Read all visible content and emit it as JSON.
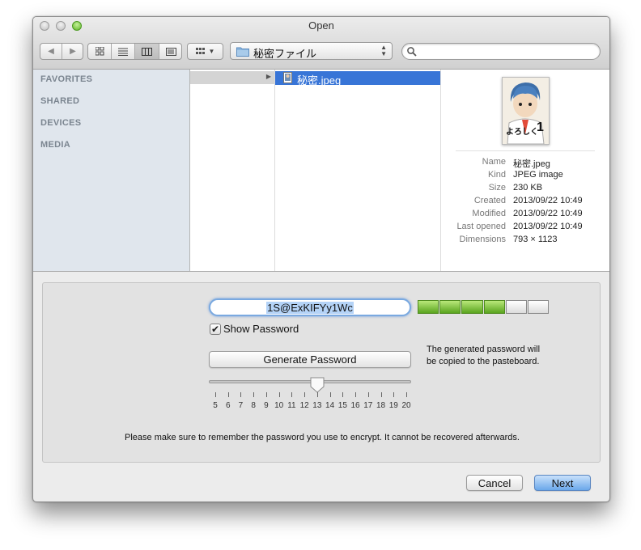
{
  "window": {
    "title": "Open"
  },
  "toolbar": {
    "path_label": "秘密ファイル",
    "search_placeholder": ""
  },
  "sidebar": {
    "sections": [
      "FAVORITES",
      "SHARED",
      "DEVICES",
      "MEDIA"
    ]
  },
  "browser": {
    "selected_file": "秘密.jpeg"
  },
  "preview": {
    "thumbnail_title": "よろしく",
    "thumbnail_number": "1",
    "info": [
      {
        "key": "Name",
        "value": "秘密.jpeg"
      },
      {
        "key": "Kind",
        "value": "JPEG image"
      },
      {
        "key": "Size",
        "value": "230 KB"
      },
      {
        "key": "Created",
        "value": "2013/09/22 10:49"
      },
      {
        "key": "Modified",
        "value": "2013/09/22 10:49"
      },
      {
        "key": "Last opened",
        "value": "2013/09/22 10:49"
      },
      {
        "key": "Dimensions",
        "value": "793 × 1123"
      }
    ]
  },
  "password_panel": {
    "password": "1S@ExKIFYy1Wc",
    "strength_filled": 4,
    "strength_total": 6,
    "show_password_label": "Show Password",
    "show_password_checked": true,
    "generate_label": "Generate Password",
    "hint": "The generated password will be copied to the pasteboard.",
    "length_value": 13,
    "length_ticks": [
      "5",
      "6",
      "7",
      "8",
      "9",
      "10",
      "11",
      "12",
      "13",
      "14",
      "15",
      "16",
      "17",
      "18",
      "19",
      "20"
    ],
    "notice": "Please make sure to remember the password you use to encrypt. It cannot be recovered afterwards."
  },
  "buttons": {
    "cancel": "Cancel",
    "next": "Next"
  },
  "colors": {
    "selection": "#3875d7",
    "strength_on": "#5aa51f",
    "default_button": "#6aa7ea"
  }
}
